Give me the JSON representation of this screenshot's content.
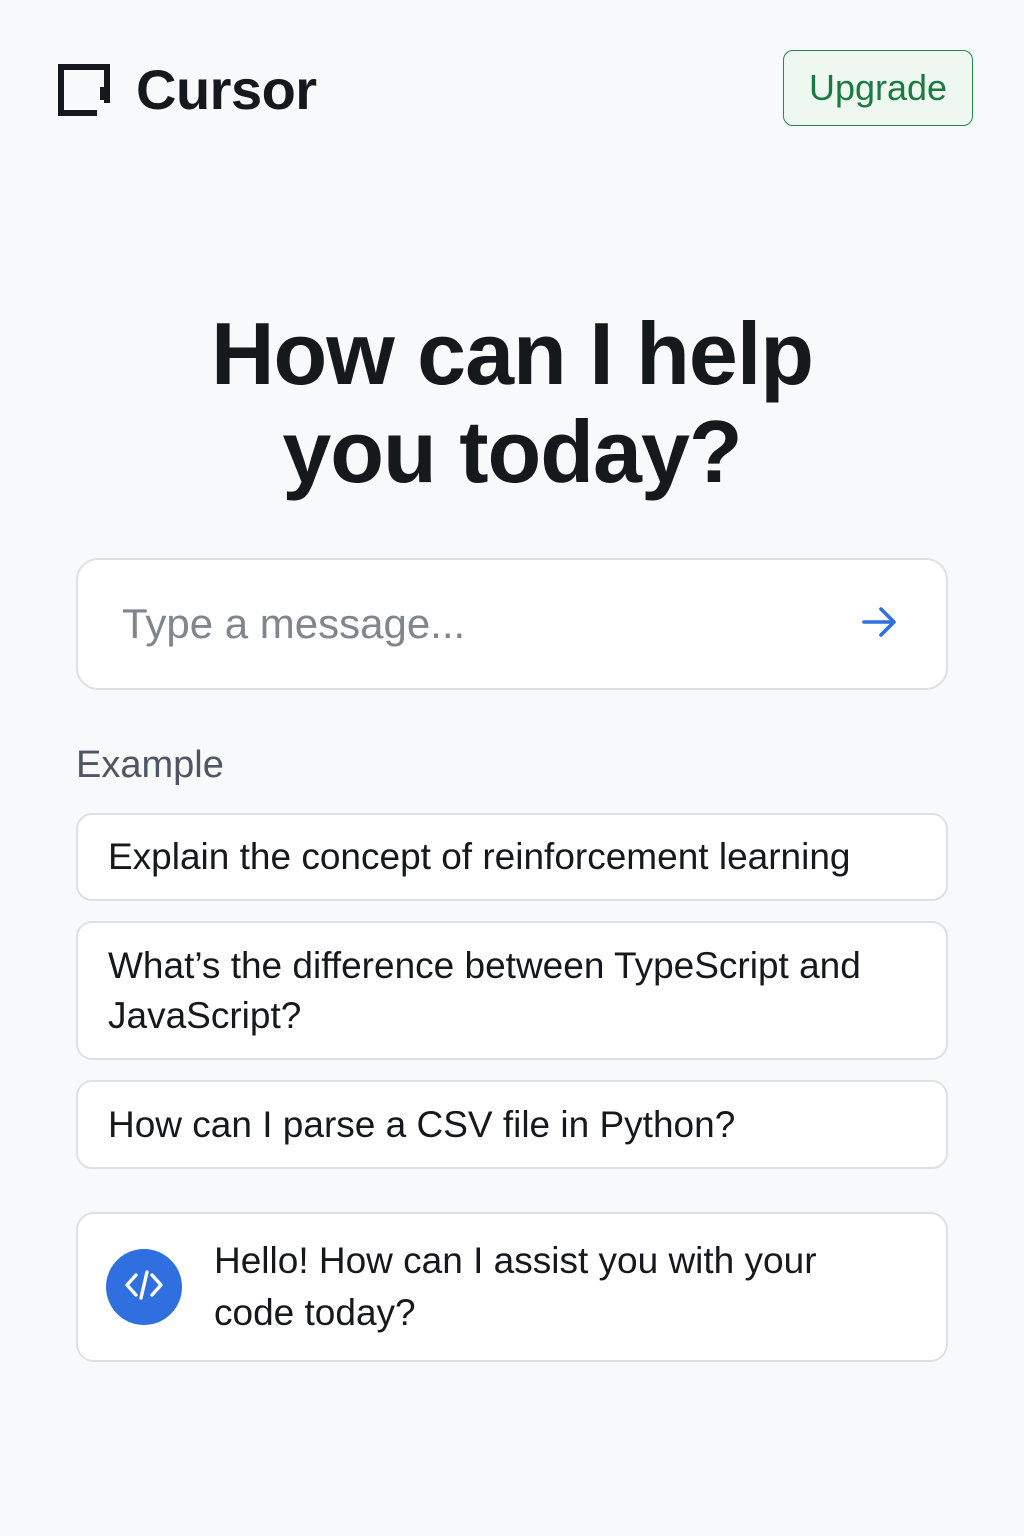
{
  "app": {
    "name": "Cursor",
    "logo_icon": "cursor-logo-icon"
  },
  "header": {
    "upgrade_label": "Upgrade",
    "upgrade_color": "#1b7a42"
  },
  "hero": {
    "line1": "How can I help",
    "line2": "you today?"
  },
  "composer": {
    "value": "",
    "placeholder": "Type a message...",
    "send_icon": "arrow-right-icon",
    "accent": "#2f6fe0"
  },
  "examples": {
    "label": "Example",
    "items": [
      {
        "text": "Explain the concept of reinforcement learning"
      },
      {
        "text": "What’s the difference between TypeScript and JavaScript?"
      },
      {
        "text": "How can I parse a CSV file in Python?"
      }
    ]
  },
  "assistant": {
    "avatar_icon": "code-icon",
    "avatar_color": "#2f6fe0",
    "message": "Hello! How can I assist you with your code today?"
  }
}
